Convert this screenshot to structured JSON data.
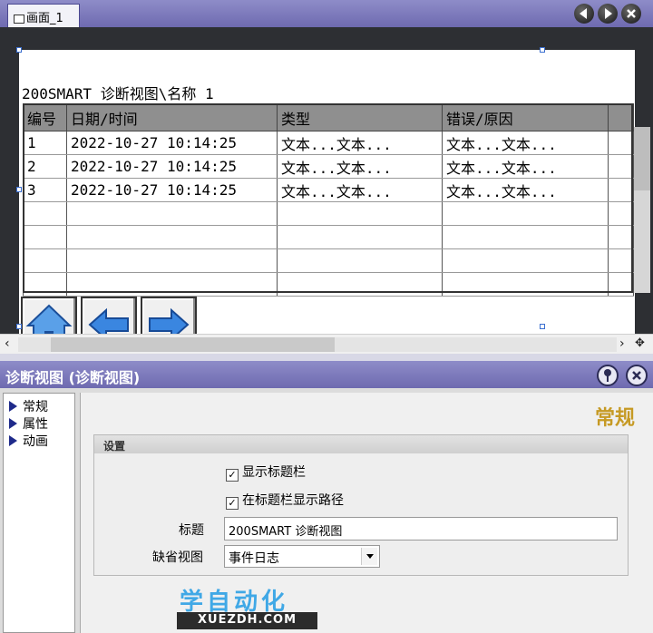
{
  "editor": {
    "tab_label": "画面_1",
    "diag_view_title": "200SMART 诊断视图\\名称 1",
    "table": {
      "columns": [
        "编号",
        "日期/时间",
        "类型",
        "错误/原因"
      ],
      "rows": [
        [
          "1",
          "2022-10-27 10:14:25",
          "文本...文本...",
          "文本...文本..."
        ],
        [
          "2",
          "2022-10-27 10:14:25",
          "文本...文本...",
          "文本...文本..."
        ],
        [
          "3",
          "2022-10-27 10:14:25",
          "文本...文本...",
          "文本...文本..."
        ]
      ]
    },
    "buttons": [
      "home-icon",
      "arrow-left-icon",
      "arrow-right-icon"
    ]
  },
  "properties": {
    "panel_title": "诊断视图 (诊断视图)",
    "nav": [
      "常规",
      "属性",
      "动画"
    ],
    "section_heading": "常规",
    "group_label": "设置",
    "show_title_bar": {
      "label": "显示标题栏",
      "checked": true
    },
    "show_path": {
      "label": "在标题栏显示路径",
      "checked": true
    },
    "title_label": "标题",
    "title_value": "200SMART 诊断视图",
    "default_view_label": "缺省视图",
    "default_view_value": "事件日志"
  },
  "watermark": {
    "cn": "学自动化",
    "en": "XUEZDH.COM"
  },
  "colors": {
    "title_bar": "#7e7bbe",
    "header_row": "#8f8f8f",
    "accent_heading": "#c69a24",
    "watermark": "#40a8e6"
  }
}
